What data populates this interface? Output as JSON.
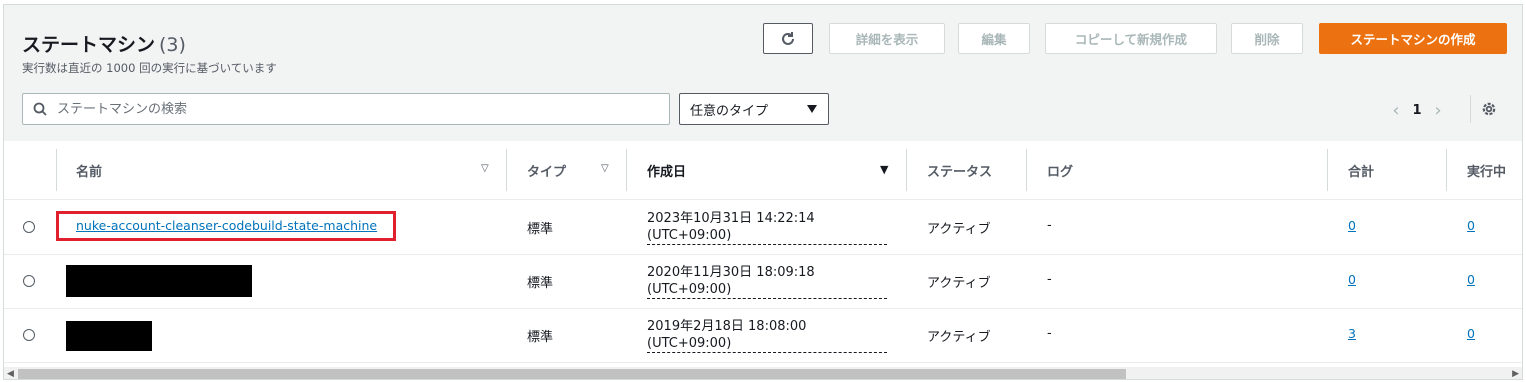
{
  "header": {
    "title": "ステートマシン",
    "count": "(3)",
    "subtitle": "実行数は直近の 1000 回の実行に基づいています"
  },
  "toolbar": {
    "details": "詳細を表示",
    "edit": "編集",
    "copy": "コピーして新規作成",
    "delete": "削除",
    "create": "ステートマシンの作成",
    "primary_color": "#ec7211"
  },
  "filter": {
    "search_placeholder": "ステートマシンの検索",
    "type_select": "任意のタイプ"
  },
  "pagination": {
    "page": "1"
  },
  "table": {
    "columns": [
      "名前",
      "タイプ",
      "作成日",
      "ステータス",
      "ログ",
      "合計",
      "実行中"
    ],
    "rows": [
      {
        "name": "nuke-account-cleanser-codebuild-state-machine",
        "type": "標準",
        "date_line1": "2023年10月31日 14:22:14",
        "date_line2": "(UTC+09:00)",
        "status": "アクティブ",
        "log": "-",
        "total": "0",
        "running": "0"
      },
      {
        "name": "",
        "type": "標準",
        "date_line1": "2020年11月30日 18:09:18",
        "date_line2": "(UTC+09:00)",
        "status": "アクティブ",
        "log": "-",
        "total": "0",
        "running": "0"
      },
      {
        "name": "",
        "type": "標準",
        "date_line1": "2019年2月18日 18:08:00",
        "date_line2": "(UTC+09:00)",
        "status": "アクティブ",
        "log": "-",
        "total": "3",
        "running": "0"
      }
    ]
  }
}
